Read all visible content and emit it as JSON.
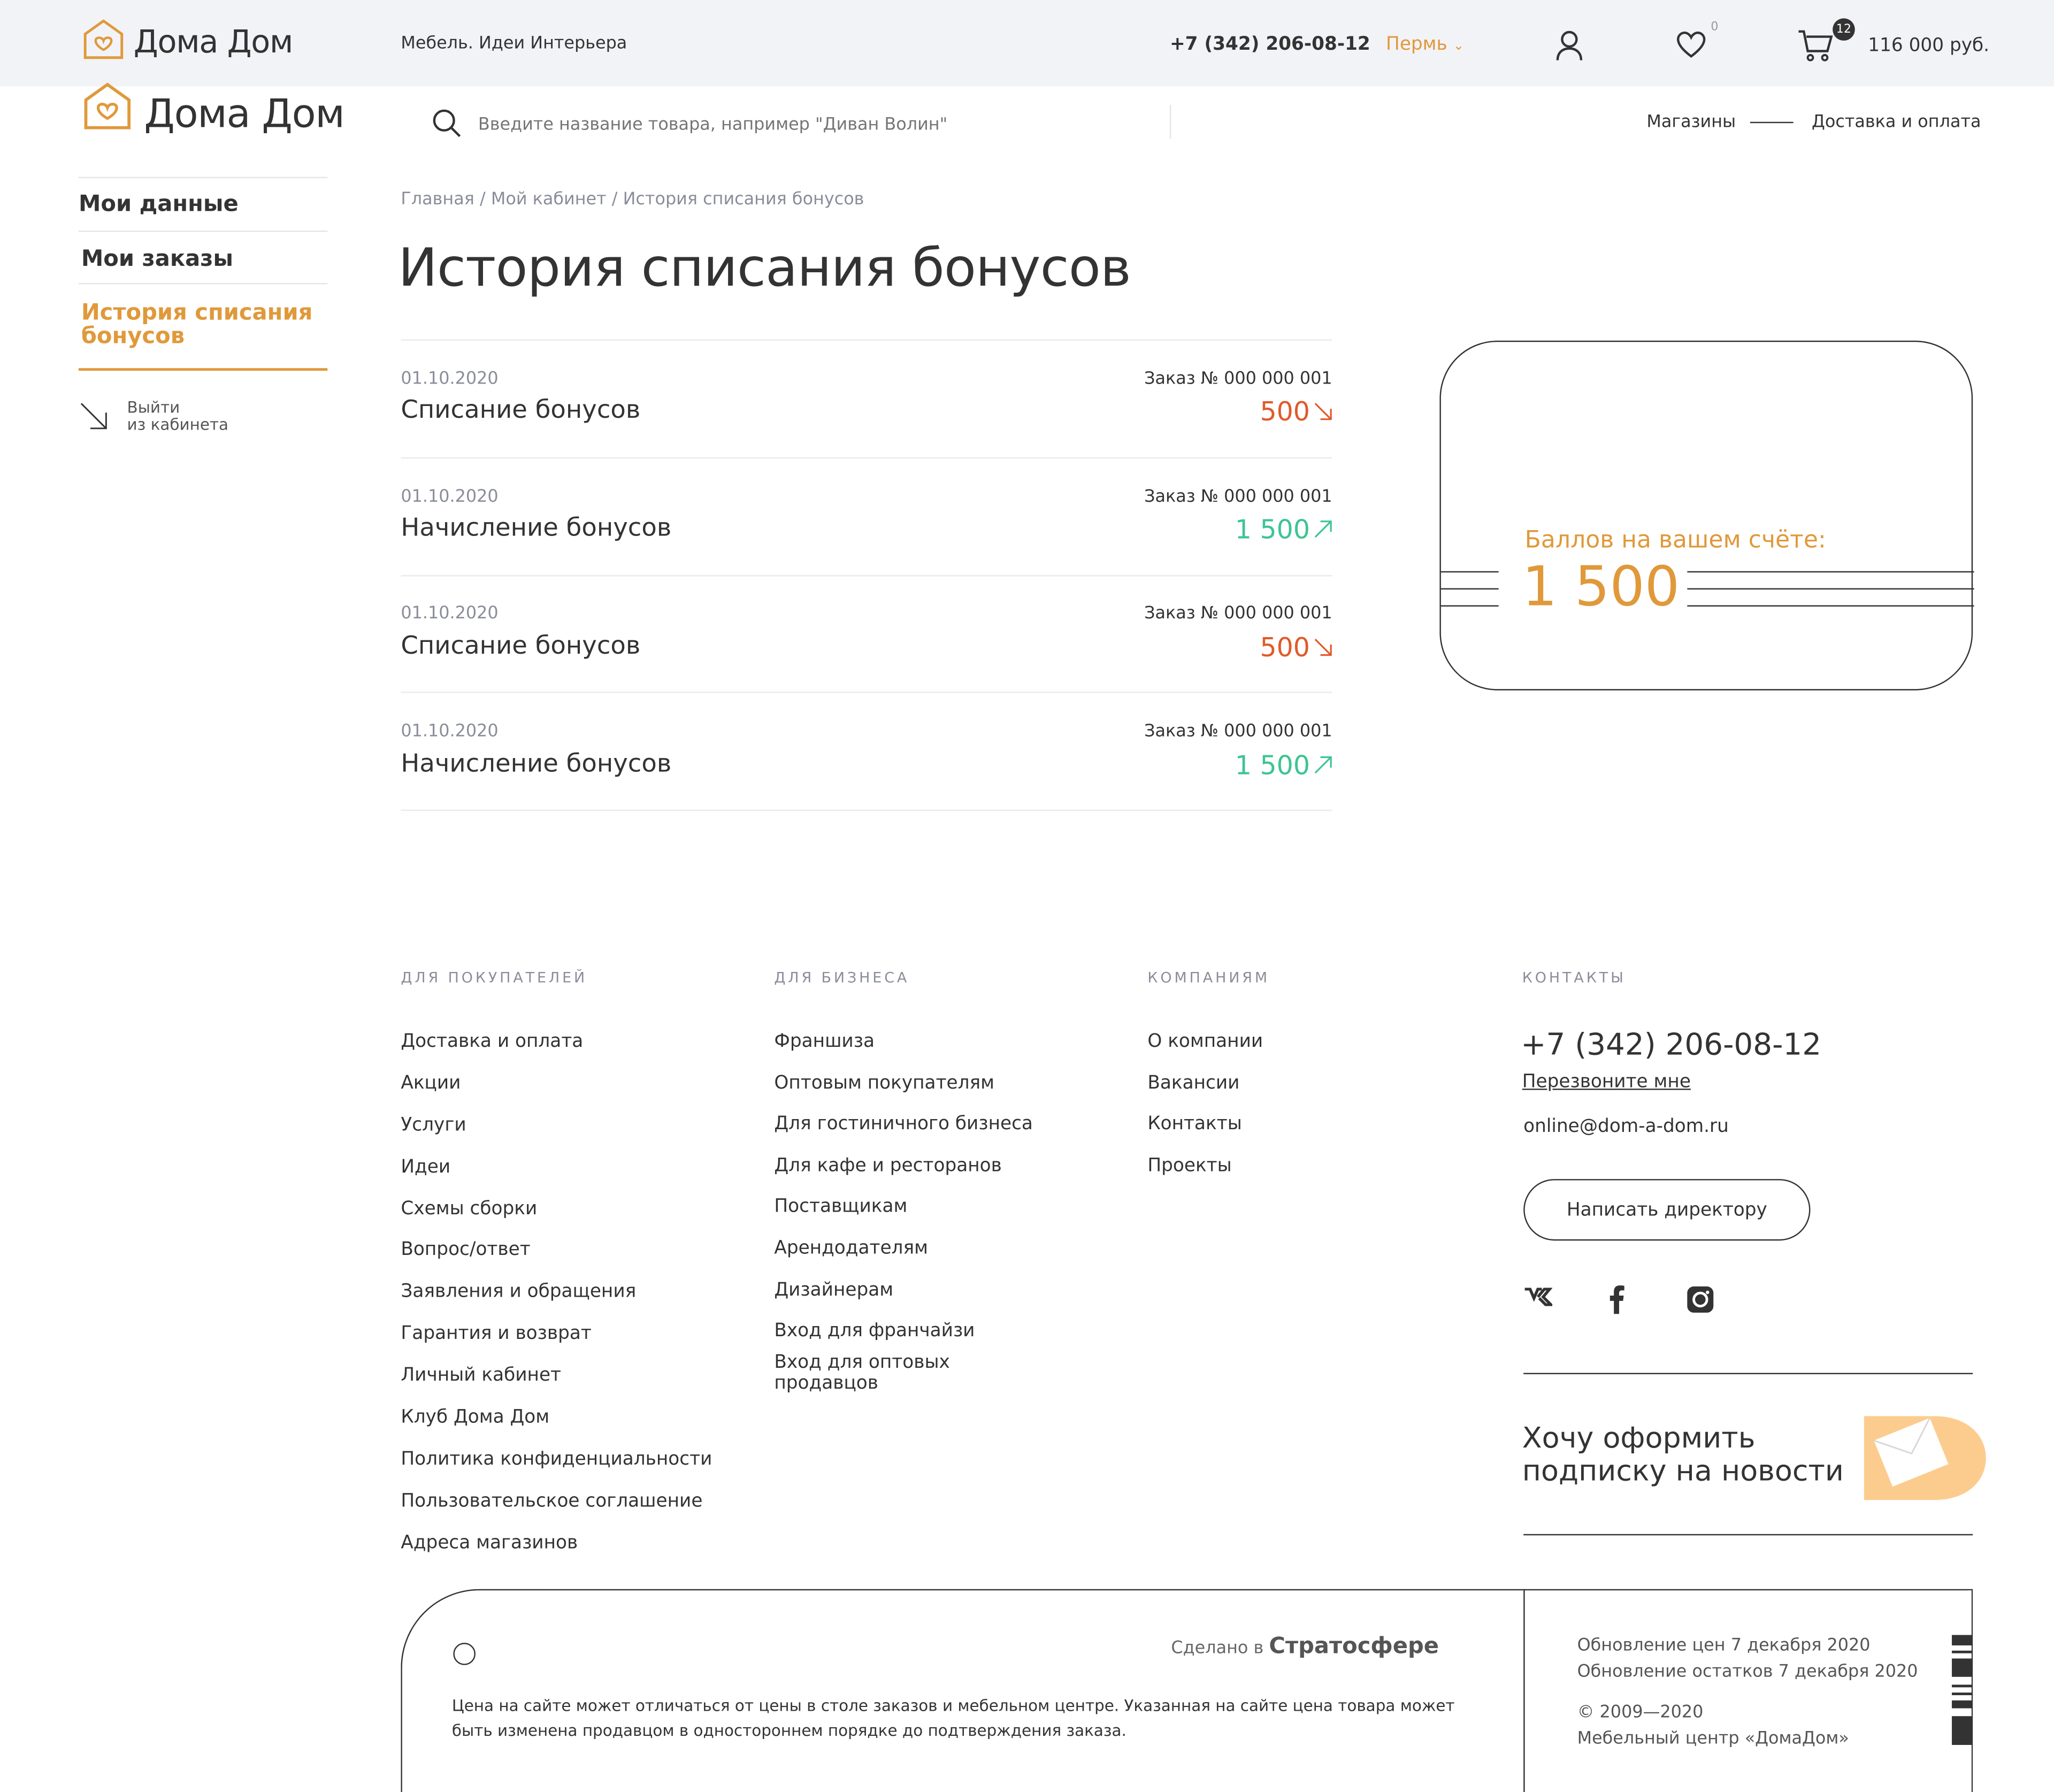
{
  "header": {
    "logo_text": "Дома Дом",
    "tagline": "Мебель. Идеи Интерьера",
    "phone": "+7 (342) 206-08-12",
    "city": "Пермь",
    "favorites_count": "0",
    "cart_count": "12",
    "cart_total": "116 000 руб."
  },
  "subheader": {
    "logo_text": "Дома Дом",
    "search_placeholder": "Введите название товара, например \"Диван Волин\"",
    "links": [
      "Магазины",
      "Доставка и оплата"
    ]
  },
  "sidebar": {
    "items": [
      {
        "label": "Мои данные",
        "active": false
      },
      {
        "label": "Мои заказы",
        "active": false
      },
      {
        "label": "История списания бонусов",
        "active": true
      }
    ],
    "logout_line1": "Выйти",
    "logout_line2": "из кабинета"
  },
  "breadcrumb": "Главная / Мой кабинет / История списания бонусов",
  "page_title": "История списания бонусов",
  "transactions": [
    {
      "date": "01.10.2020",
      "title": "Списание бонусов",
      "order": "Заказ № 000 000 001",
      "amount": "500",
      "type": "debit"
    },
    {
      "date": "01.10.2020",
      "title": "Начисление бонусов",
      "order": "Заказ № 000 000 001",
      "amount": "1 500",
      "type": "credit"
    },
    {
      "date": "01.10.2020",
      "title": "Списание бонусов",
      "order": "Заказ № 000 000 001",
      "amount": "500",
      "type": "debit"
    },
    {
      "date": "01.10.2020",
      "title": "Начисление бонусов",
      "order": "Заказ № 000 000 001",
      "amount": "1 500",
      "type": "credit"
    }
  ],
  "bonus_card": {
    "label": "Баллов на вашем счёте:",
    "value": "1 500"
  },
  "footer": {
    "buyers": {
      "heading": "ДЛЯ ПОКУПАТЕЛЕЙ",
      "links": [
        "Доставка и оплата",
        "Акции",
        "Услуги",
        "Идеи",
        "Схемы сборки",
        "Вопрос/ответ",
        "Заявления и обращения",
        "Гарантия и возврат",
        "Личный кабинет",
        "Клуб Дома Дом",
        "Политика конфиденциальности",
        "Пользовательское соглашение",
        "Адреса магазинов"
      ]
    },
    "business": {
      "heading": "ДЛЯ БИЗНЕСА",
      "links": [
        "Франшиза",
        "Оптовым покупателям",
        "Для гостиничного бизнеса",
        "Для кафе и ресторанов",
        "Поставщикам",
        "Арендодателям",
        "Дизайнерам",
        "Вход для франчайзи",
        "Вход для оптовых продавцов"
      ]
    },
    "company": {
      "heading": "КОМПАНИЯМ",
      "links": [
        "О компании",
        "Вакансии",
        "Контакты",
        "Проекты"
      ]
    },
    "contacts": {
      "heading": "КОНТАКТЫ",
      "phone": "+7 (342) 206-08-12",
      "callback": "Перезвоните мне",
      "email": "online@dom-a-dom.ru",
      "director_button": "Написать директору"
    },
    "subscribe_line1": "Хочу оформить",
    "subscribe_line2": "подписку на новости",
    "made_in_prefix": "Сделано в",
    "made_in_brand": "Стратосфере",
    "disclaimer_line1": "Цена на сайте может отличаться от цены в столе заказов и мебельном центре. Указанная на сайте цена товара может",
    "disclaimer_line2": "быть изменена продавцом в одностороннем порядке до подтверждения заказа.",
    "price_update": "Обновление цен 7 декабря 2020",
    "stock_update": "Обновление остатков 7 декабря 2020",
    "copyright": "© 2009—2020",
    "company_name": "Мебельный центр «ДомаДом»"
  },
  "colors": {
    "accent": "#e0993a",
    "debit": "#e05a2a",
    "credit": "#3dc493",
    "topbar_bg": "#f2f3f7"
  }
}
